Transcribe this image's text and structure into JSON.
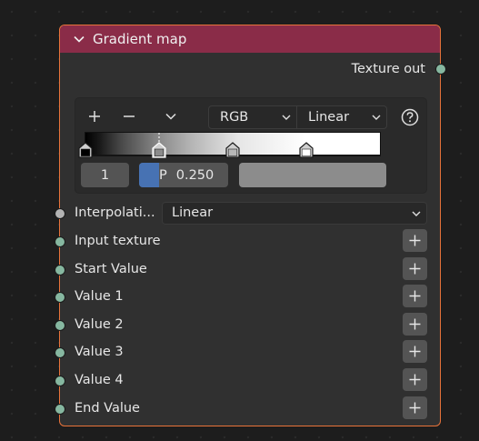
{
  "node": {
    "title": "Gradient map",
    "output_label": "Texture out",
    "colors": {
      "header": "#8a2c48",
      "border": "#e8733a",
      "socket": "#86b7a0",
      "selected_field": "#4772b3"
    }
  },
  "ramp": {
    "tools": {
      "add_icon": "plus-icon",
      "remove_icon": "minus-icon",
      "menu_icon": "chevron-down-icon"
    },
    "color_mode": "RGB",
    "interpolation": "Linear",
    "help_icon": "question-icon",
    "active_index": "1",
    "position_label": "P",
    "position_value": "0.250",
    "stops": [
      {
        "pos": 0.0,
        "color": "#000000"
      },
      {
        "pos": 0.25,
        "color": "#8c8c8c",
        "active": true
      },
      {
        "pos": 0.5,
        "color": "#b8b8b8"
      },
      {
        "pos": 0.75,
        "color": "#ffffff"
      }
    ]
  },
  "inputs": {
    "interpolation_label": "Interpolati...",
    "interpolation_value": "Linear",
    "items": [
      "Input texture",
      "Start Value",
      "Value 1",
      "Value 2",
      "Value 3",
      "Value 4",
      "End Value"
    ]
  }
}
